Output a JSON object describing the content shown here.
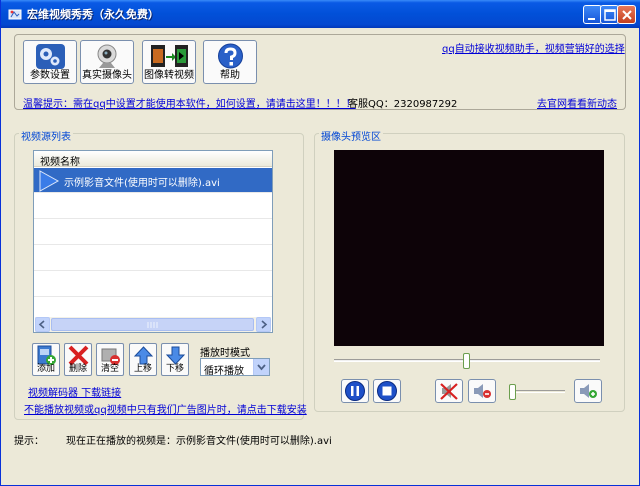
{
  "window": {
    "title": "宏维视频秀秀（永久免费）"
  },
  "toolbar": {
    "params_label": "参数设置",
    "camera_label": "真实摄像头",
    "image_video_label": "图像转视频",
    "help_label": "帮助"
  },
  "header": {
    "qq_auto_link": "qq自动接收视频助手，视频营销好的选择",
    "tip_link": "温馨提示：需在qq中设置才能使用本软件，如何设置，请请击这里！！！！",
    "service_qq": "客服QQ：2320987292",
    "website_link": "去官网看看新动态"
  },
  "video_list": {
    "group_title": "视频源列表",
    "column_header": "视频名称",
    "rows": [
      "示例影音文件(使用时可以删除).avi"
    ],
    "selected_index": 0
  },
  "list_buttons": {
    "add": "添加",
    "delete": "删除",
    "clear": "清空",
    "up": "上移",
    "down": "下移"
  },
  "play_mode": {
    "label": "播放时模式",
    "selected": "循环播放"
  },
  "bottom_links": {
    "decoder": "视频解码器  下载链接",
    "ad_notice": "不能播放视频或qq视频中只有我们广告图片时，请点击下载安装"
  },
  "preview": {
    "group_title": "摄像头预览区",
    "position": 0.5,
    "volume": 0.05
  },
  "status": {
    "label": "提示：",
    "message": "现在正在播放的视频是：示例影音文件(使用时可以删除).avi"
  },
  "colors": {
    "accent": "#0046d5",
    "link": "#0000d6",
    "selection": "#316ac5",
    "preview_bg": "#0d0308"
  }
}
